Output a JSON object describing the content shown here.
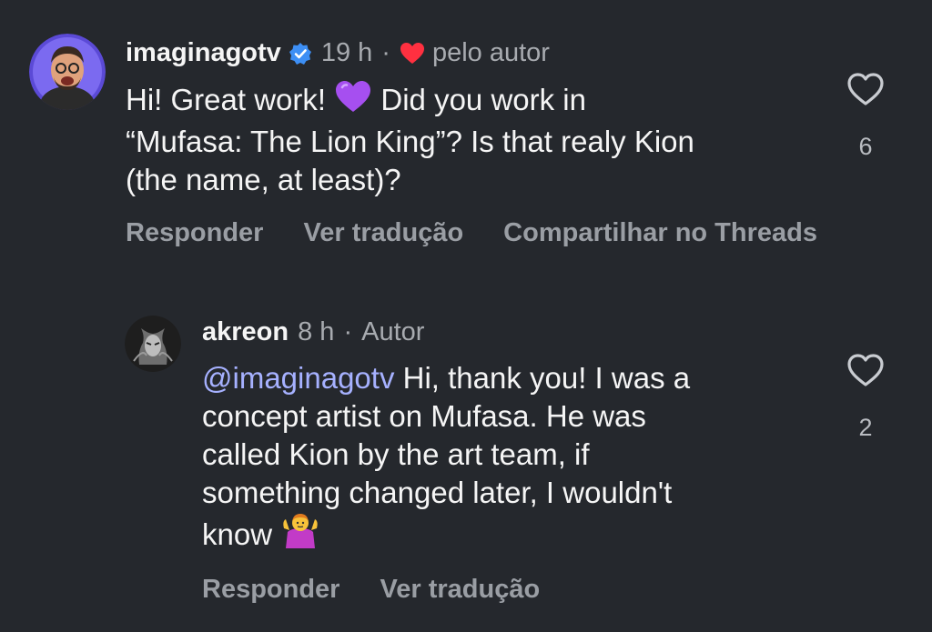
{
  "colors": {
    "background": "#25282d",
    "text": "#f5f5f5",
    "muted": "#a8abb0",
    "mention": "#a6b1ff",
    "verified": "#3d8ff5",
    "author_heart": "#ff3040"
  },
  "comments": [
    {
      "username": "imaginagotv",
      "verified": true,
      "time": "19 h",
      "separator": "·",
      "author_liked_label": "pelo autor",
      "text_part1": "Hi! Great work! ",
      "emoji": "purple-heart",
      "text_part2": " Did you work in\n“Mufasa: The Lion King”? Is that realy Kion\n(the name, at least)?",
      "actions": [
        "Responder",
        "Ver tradução",
        "Compartilhar no Threads"
      ],
      "like_count": "6",
      "icons": {
        "like": "heart-outline-icon",
        "author_like": "heart-filled-icon"
      }
    }
  ],
  "replies": [
    {
      "username": "akreon",
      "time": "8 h",
      "separator": "·",
      "role": "Autor",
      "mention": "@imaginagotv",
      "text": " Hi, thank you! I was a\nconcept artist on Mufasa. He was\ncalled Kion by the art team, if\nsomething changed later, I wouldn't\nknow ",
      "emoji": "person-shrugging",
      "actions": [
        "Responder",
        "Ver tradução"
      ],
      "like_count": "2",
      "icons": {
        "like": "heart-outline-icon"
      }
    }
  ]
}
